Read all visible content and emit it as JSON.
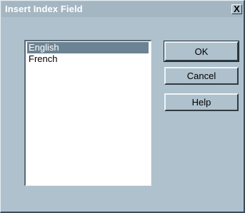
{
  "window": {
    "title": "Insert Index Field",
    "close_label": "X"
  },
  "list": {
    "items": [
      {
        "label": "English",
        "selected": true
      },
      {
        "label": "French",
        "selected": false
      }
    ]
  },
  "buttons": {
    "ok_label": "OK",
    "cancel_label": "Cancel",
    "help_label": "Help"
  },
  "colors": {
    "dialog_background": "#aec1cd",
    "selection": "#6c8393"
  }
}
